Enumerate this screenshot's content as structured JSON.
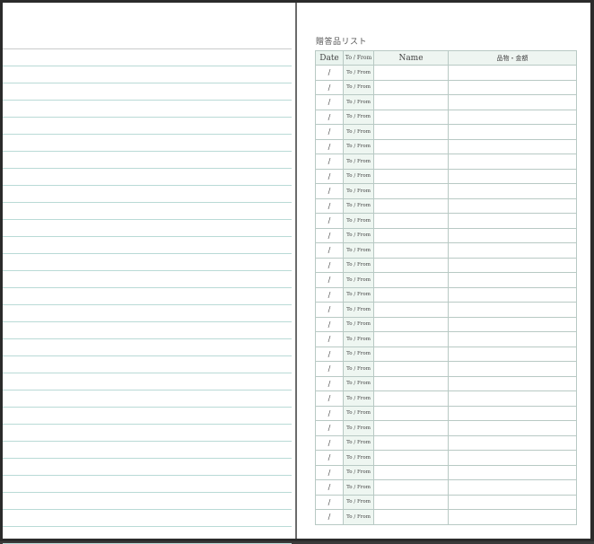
{
  "list": {
    "title": "贈答品リスト",
    "headers": {
      "date": "Date",
      "tofrom": "To / From",
      "name": "Name",
      "item": "品物・金額"
    },
    "rows": [
      {
        "date": "/",
        "tofrom": "To / From"
      },
      {
        "date": "/",
        "tofrom": "To / From"
      },
      {
        "date": "/",
        "tofrom": "To / From"
      },
      {
        "date": "/",
        "tofrom": "To / From"
      },
      {
        "date": "/",
        "tofrom": "To / From"
      },
      {
        "date": "/",
        "tofrom": "To / From"
      },
      {
        "date": "/",
        "tofrom": "To / From"
      },
      {
        "date": "/",
        "tofrom": "To / From"
      },
      {
        "date": "/",
        "tofrom": "To / From"
      },
      {
        "date": "/",
        "tofrom": "To / From"
      },
      {
        "date": "/",
        "tofrom": "To / From"
      },
      {
        "date": "/",
        "tofrom": "To / From"
      },
      {
        "date": "/",
        "tofrom": "To / From"
      },
      {
        "date": "/",
        "tofrom": "To / From"
      },
      {
        "date": "/",
        "tofrom": "To / From"
      },
      {
        "date": "/",
        "tofrom": "To / From"
      },
      {
        "date": "/",
        "tofrom": "To / From"
      },
      {
        "date": "/",
        "tofrom": "To / From"
      },
      {
        "date": "/",
        "tofrom": "To / From"
      },
      {
        "date": "/",
        "tofrom": "To / From"
      },
      {
        "date": "/",
        "tofrom": "To / From"
      },
      {
        "date": "/",
        "tofrom": "To / From"
      },
      {
        "date": "/",
        "tofrom": "To / From"
      },
      {
        "date": "/",
        "tofrom": "To / From"
      },
      {
        "date": "/",
        "tofrom": "To / From"
      },
      {
        "date": "/",
        "tofrom": "To / From"
      },
      {
        "date": "/",
        "tofrom": "To / From"
      },
      {
        "date": "/",
        "tofrom": "To / From"
      },
      {
        "date": "/",
        "tofrom": "To / From"
      },
      {
        "date": "/",
        "tofrom": "To / From"
      },
      {
        "date": "/",
        "tofrom": "To / From"
      }
    ]
  },
  "colors": {
    "rule_line": "#b9dad6",
    "header_bg": "#eaf4ef",
    "tofrom_bg": "#eef6f1",
    "grid_border": "#b8c9c4"
  }
}
